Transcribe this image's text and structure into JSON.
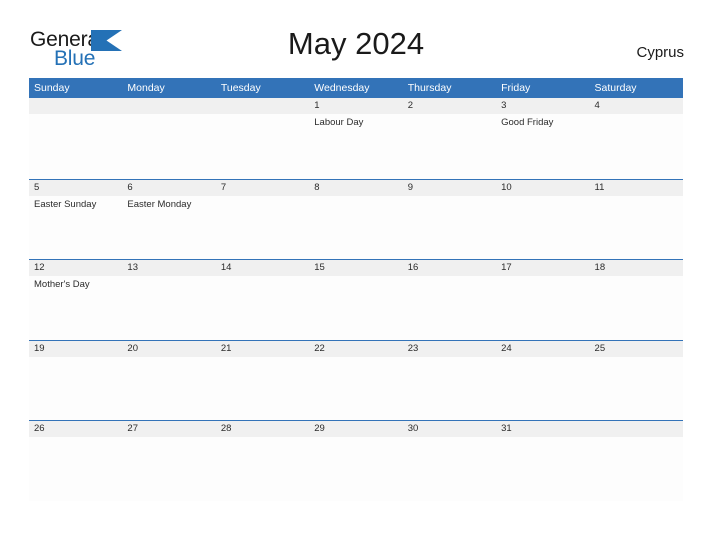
{
  "logo": {
    "word_one": "General",
    "word_two": "Blue",
    "flag_icon": "blue-triangle-flag-icon",
    "dark_color": "#1a1a1a",
    "blue_color": "#2471b6"
  },
  "header": {
    "title": "May 2024",
    "region": "Cyprus"
  },
  "theme": {
    "header_blue": "#3373b8",
    "date_strip_gray": "#f0f0f0",
    "cell_white": "#fdfdfd",
    "text_dark": "#2b2b2b"
  },
  "calendar": {
    "weekdays": [
      "Sunday",
      "Monday",
      "Tuesday",
      "Wednesday",
      "Thursday",
      "Friday",
      "Saturday"
    ],
    "weeks": [
      {
        "days": [
          {
            "date": "",
            "event": ""
          },
          {
            "date": "",
            "event": ""
          },
          {
            "date": "",
            "event": ""
          },
          {
            "date": "1",
            "event": "Labour Day"
          },
          {
            "date": "2",
            "event": ""
          },
          {
            "date": "3",
            "event": "Good Friday"
          },
          {
            "date": "4",
            "event": ""
          }
        ]
      },
      {
        "days": [
          {
            "date": "5",
            "event": "Easter Sunday"
          },
          {
            "date": "6",
            "event": "Easter Monday"
          },
          {
            "date": "7",
            "event": ""
          },
          {
            "date": "8",
            "event": ""
          },
          {
            "date": "9",
            "event": ""
          },
          {
            "date": "10",
            "event": ""
          },
          {
            "date": "11",
            "event": ""
          }
        ]
      },
      {
        "days": [
          {
            "date": "12",
            "event": "Mother's Day"
          },
          {
            "date": "13",
            "event": ""
          },
          {
            "date": "14",
            "event": ""
          },
          {
            "date": "15",
            "event": ""
          },
          {
            "date": "16",
            "event": ""
          },
          {
            "date": "17",
            "event": ""
          },
          {
            "date": "18",
            "event": ""
          }
        ]
      },
      {
        "days": [
          {
            "date": "19",
            "event": ""
          },
          {
            "date": "20",
            "event": ""
          },
          {
            "date": "21",
            "event": ""
          },
          {
            "date": "22",
            "event": ""
          },
          {
            "date": "23",
            "event": ""
          },
          {
            "date": "24",
            "event": ""
          },
          {
            "date": "25",
            "event": ""
          }
        ]
      },
      {
        "days": [
          {
            "date": "26",
            "event": ""
          },
          {
            "date": "27",
            "event": ""
          },
          {
            "date": "28",
            "event": ""
          },
          {
            "date": "29",
            "event": ""
          },
          {
            "date": "30",
            "event": ""
          },
          {
            "date": "31",
            "event": ""
          },
          {
            "date": "",
            "event": ""
          }
        ]
      }
    ]
  }
}
